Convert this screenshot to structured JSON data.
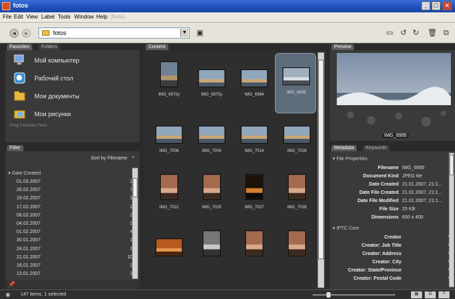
{
  "window": {
    "title": "fotos"
  },
  "menu": [
    "File",
    "Edit",
    "View",
    "Label",
    "Tools",
    "Window",
    "Help",
    "(Beta)"
  ],
  "path": {
    "folder": "fotos"
  },
  "tabs": {
    "favorites": "Favorites",
    "folders": "Folders",
    "content": "Content",
    "preview": "Preview",
    "filter": "Filter",
    "metadata": "Metadata",
    "keywords": "Keywords"
  },
  "favorites": [
    {
      "label": "Мой компьютер",
      "icon": "computer-icon"
    },
    {
      "label": "Рабочий стол",
      "icon": "desktop-icon"
    },
    {
      "label": "Мои документы",
      "icon": "documents-folder-icon"
    },
    {
      "label": "Мои рисунки",
      "icon": "pictures-folder-icon"
    }
  ],
  "favorites_hint": "Drag Favorites Here...",
  "filter": {
    "sort_label": "Sort by Filename",
    "group": "Date Created",
    "rows": [
      {
        "date": "01.03.2007",
        "count": "2"
      },
      {
        "date": "26.02.2007",
        "count": "7"
      },
      {
        "date": "18.02.2007",
        "count": "3"
      },
      {
        "date": "17.02.2007",
        "count": "2"
      },
      {
        "date": "08.02.2007",
        "count": "2"
      },
      {
        "date": "04.02.2007",
        "count": "3"
      },
      {
        "date": "01.02.2007",
        "count": "4"
      },
      {
        "date": "30.01.2007",
        "count": "1"
      },
      {
        "date": "24.01.2007",
        "count": "3"
      },
      {
        "date": "21.01.2007",
        "count": "10"
      },
      {
        "date": "16.01.2007",
        "count": "3"
      },
      {
        "date": "13.01.2007",
        "count": "1"
      }
    ]
  },
  "content": {
    "items": [
      {
        "name": "IMG_6972y",
        "tone": "portrait-sea"
      },
      {
        "name": "IMG_6975y",
        "tone": "beach"
      },
      {
        "name": "IMG_6984",
        "tone": "beach"
      },
      {
        "name": "IMG_6995",
        "tone": "sea",
        "selected": true
      },
      {
        "name": "IMG_7006",
        "tone": "beach"
      },
      {
        "name": "IMG_7004",
        "tone": "beach"
      },
      {
        "name": "IMG_7014",
        "tone": "beach"
      },
      {
        "name": "IMG_7026",
        "tone": "beach"
      },
      {
        "name": "IMG_7022",
        "tone": "portrait"
      },
      {
        "name": "IMG_7025",
        "tone": "portrait"
      },
      {
        "name": "IMG_7027",
        "tone": "dark"
      },
      {
        "name": "IMG_7035",
        "tone": "portrait"
      },
      {
        "name": "",
        "tone": "warm"
      },
      {
        "name": "",
        "tone": "gray"
      },
      {
        "name": "",
        "tone": "portrait"
      },
      {
        "name": "",
        "tone": "portrait"
      }
    ]
  },
  "preview": {
    "caption": "IMG_6995"
  },
  "metadata": {
    "section_file": "File Properties",
    "file_props": [
      {
        "key": "Filename",
        "value": "IMG_6995"
      },
      {
        "key": "Document Kind",
        "value": "JPEG file"
      },
      {
        "key": "Date Created",
        "value": "21.01.2007, 21:1..."
      },
      {
        "key": "Date File Created",
        "value": "21.01.2007, 21:1..."
      },
      {
        "key": "Date File Modified",
        "value": "21.01.2007, 21:1..."
      },
      {
        "key": "File Size",
        "value": "25 KB"
      },
      {
        "key": "Dimensions",
        "value": "600 x 400"
      }
    ],
    "section_iptc": "IPTC Core",
    "iptc": [
      "Creator",
      "Creator: Job Title",
      "Creator: Address",
      "Creator: City",
      "Creator: State/Province",
      "Creator: Postal Code"
    ]
  },
  "status": {
    "text": "147 items, 1 selected"
  },
  "colors": {
    "selection": "#5c6c7a",
    "accent": "#ffffff"
  }
}
